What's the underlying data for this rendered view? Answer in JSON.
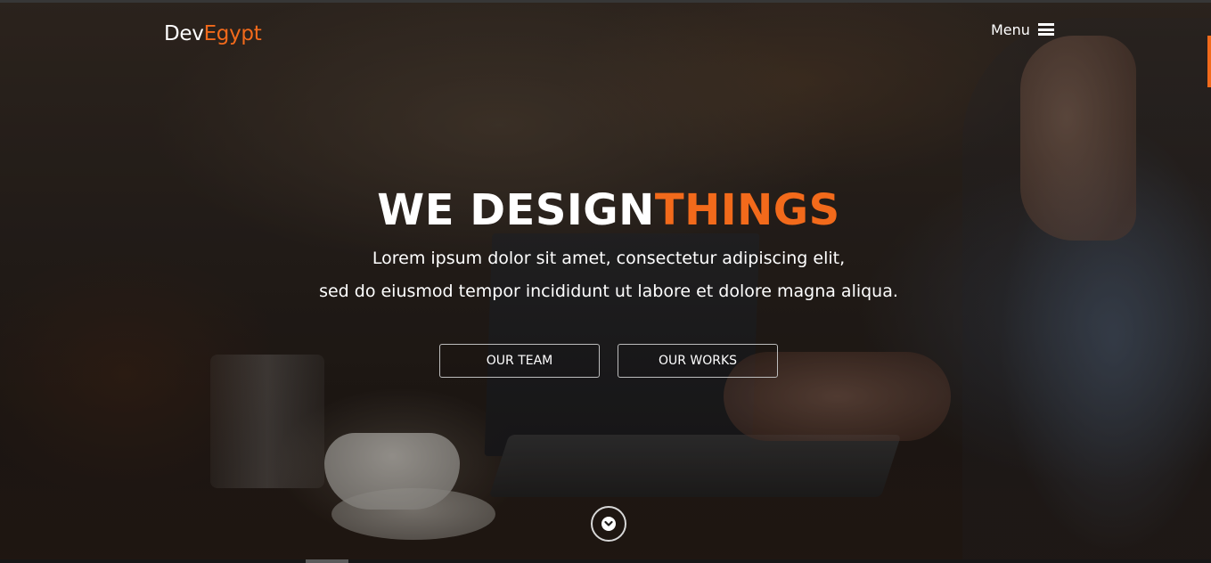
{
  "brand": {
    "part1": "Dev",
    "part2": "Egypt"
  },
  "nav": {
    "menu_label": "Menu",
    "menu_icon": "hamburger-icon"
  },
  "hero": {
    "headline_part1": "WE DESIGN",
    "headline_part2": "THINGS",
    "subline1": "Lorem ipsum dolor sit amet, consectetur adipiscing elit,",
    "subline2": "sed do eiusmod tempor incididunt ut labore et dolore magna aliqua.",
    "buttons": [
      {
        "label": "OUR TEAM"
      },
      {
        "label": "OUR WORKS"
      }
    ],
    "scroll_icon": "chevron-down-icon"
  },
  "colors": {
    "accent": "#f26a1b",
    "text": "#ffffff"
  }
}
